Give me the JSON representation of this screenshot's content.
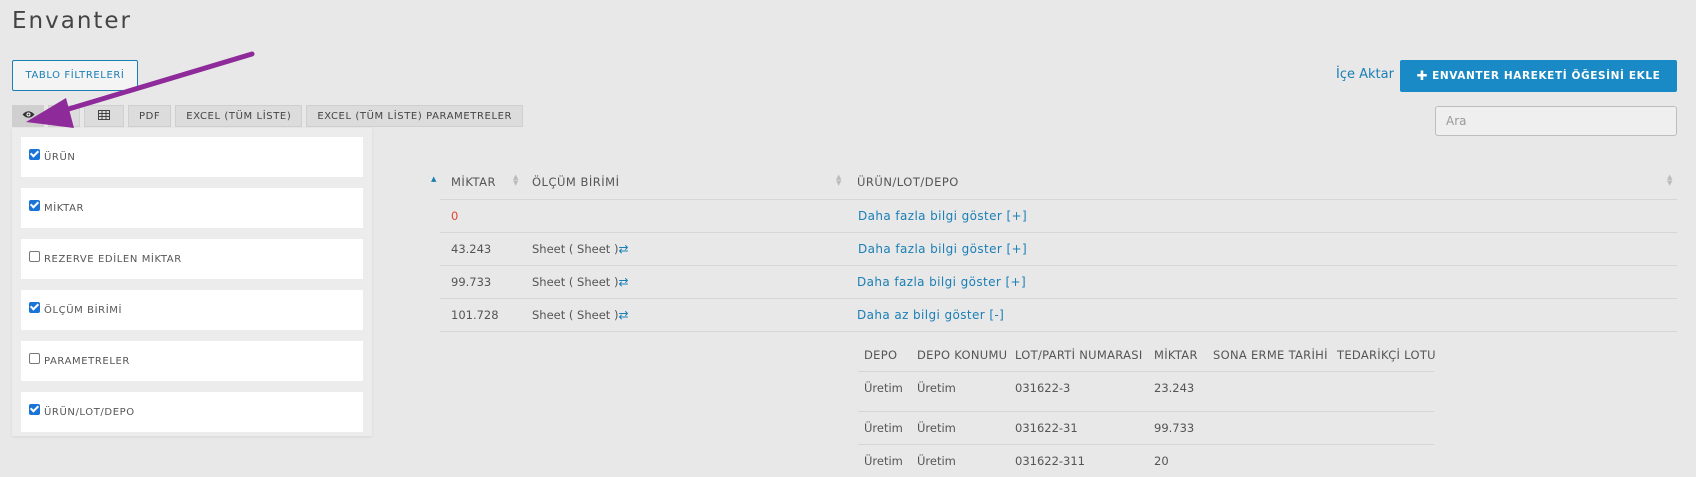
{
  "page": {
    "title": "Envanter"
  },
  "actions": {
    "table_filters_label": "TABLO FİLTRELERİ",
    "import_label": "İçe Aktar",
    "add_label": "ENVANTER HAREKETİ ÖĞESİNİ EKLE",
    "add_icon": "plus-icon"
  },
  "toolbar": {
    "buttons": [
      {
        "icon": "eye-icon"
      },
      {
        "icon": "copy-icon"
      },
      {
        "icon": "table-icon"
      },
      {
        "label": "PDF"
      },
      {
        "label": "EXCEL (TÜM LİSTE)"
      },
      {
        "label": "EXCEL (TÜM LİSTE) PARAMETRELER"
      }
    ]
  },
  "search": {
    "placeholder": "Ara",
    "value": ""
  },
  "table": {
    "headers": [
      "MİKTAR",
      "ÖLÇÜM BİRİMİ",
      "ÜRÜN/LOT/DEPO"
    ],
    "rows": [
      {
        "miktar": "0",
        "birim": "",
        "detail": "Daha fazla bilgi göster [+]"
      },
      {
        "miktar": "43.243",
        "birim": "Sheet ( Sheet )",
        "detail": "Daha fazla bilgi göster [+]"
      },
      {
        "miktar": "99.733",
        "birim": "Sheet ( Sheet )",
        "detail": "Daha fazla bilgi göster [+]"
      },
      {
        "miktar": "101.728",
        "birim": "Sheet ( Sheet )",
        "detail": "Daha az bilgi göster [-]"
      }
    ]
  },
  "sub_table": {
    "headers": [
      "DEPO",
      "DEPO KONUMU",
      "LOT/PARTİ NUMARASI",
      "MİKTAR",
      "SONA ERME TARİHİ",
      "TEDARİKÇİ LOTU"
    ],
    "rows": [
      [
        "Üretim",
        "Üretim",
        "031622-3",
        "23.243",
        "",
        ""
      ],
      [
        "Üretim",
        "Üretim",
        "031622-31",
        "99.733",
        "",
        ""
      ],
      [
        "Üretim",
        "Üretim",
        "031622-311",
        "20",
        "",
        ""
      ]
    ]
  },
  "column_visibility": {
    "items": [
      {
        "label": "ÜRÜN",
        "checked": true
      },
      {
        "label": "MİKTAR",
        "checked": true
      },
      {
        "label": "REZERVE EDİLEN MİKTAR",
        "checked": false
      },
      {
        "label": "ÖLÇÜM BİRİMİ",
        "checked": true
      },
      {
        "label": "PARAMETRELER",
        "checked": false
      },
      {
        "label": "ÜRÜN/LOT/DEPO",
        "checked": true
      }
    ]
  },
  "colors": {
    "accent": "#1a8ac6",
    "link": "#1a7fb5",
    "negative": "#e0452f",
    "annotation_arrow": "#8e2a9a"
  }
}
